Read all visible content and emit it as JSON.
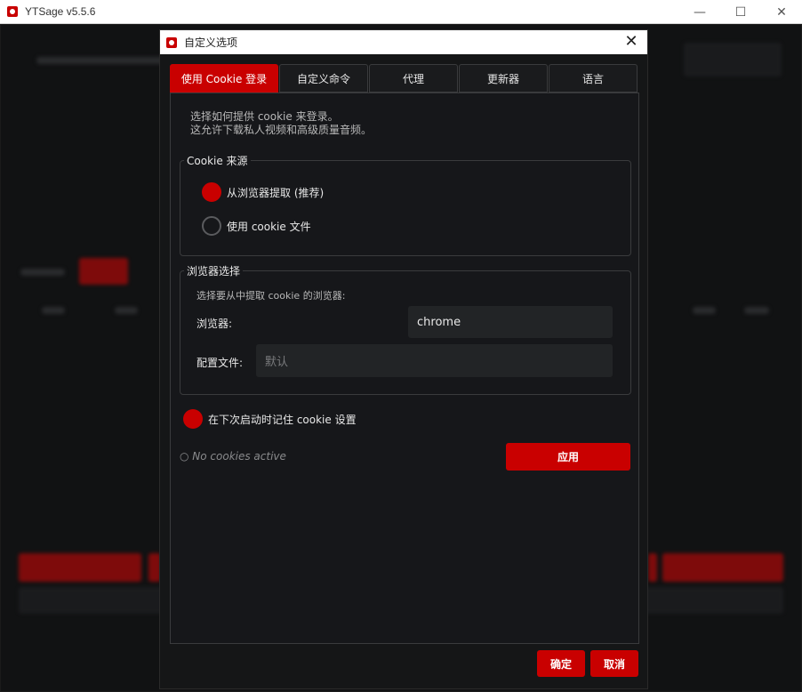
{
  "window": {
    "title": "YTSage  v5.5.6",
    "minimize": "—",
    "maximize": "☐",
    "close": "✕"
  },
  "dialog": {
    "title": "自定义选项",
    "close": "✕",
    "tabs": [
      {
        "label": "使用 Cookie 登录",
        "active": true
      },
      {
        "label": "自定义命令",
        "active": false
      },
      {
        "label": "代理",
        "active": false
      },
      {
        "label": "更新器",
        "active": false
      },
      {
        "label": "语言",
        "active": false
      }
    ],
    "description": {
      "line1": "选择如何提供 cookie 来登录。",
      "line2": "这允许下载私人视频和高级质量音频。"
    },
    "cookie_source": {
      "title": "Cookie 来源",
      "option_browser": "从浏览器提取 (推荐)",
      "option_file": "使用 cookie 文件",
      "selected": "browser"
    },
    "browser_select": {
      "title": "浏览器选择",
      "hint": "选择要从中提取 cookie 的浏览器:",
      "browser_label": "浏览器:",
      "browser_value": "chrome",
      "profile_label": "配置文件:",
      "profile_placeholder": "默认"
    },
    "remember_label": "在下次启动时记住 cookie 设置",
    "status_text": "○ No cookies active",
    "apply_button": "应用",
    "ok_button": "确定",
    "cancel_button": "取消"
  },
  "colors": {
    "accent": "#c90000",
    "background": "#111213",
    "panel": "#16171a"
  }
}
